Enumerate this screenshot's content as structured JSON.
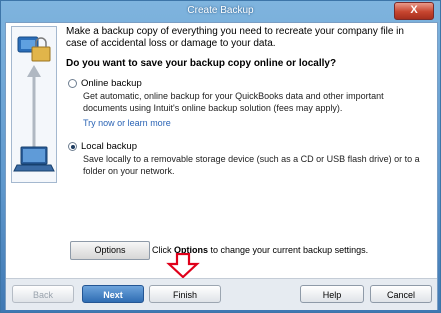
{
  "window": {
    "title": "Create Backup",
    "close_label": "X"
  },
  "intro": "Make a backup copy of everything you need to recreate your company file in case of accidental loss or damage to your data.",
  "question": "Do you want to save your backup copy online or locally?",
  "options": {
    "online": {
      "label": "Online backup",
      "description": "Get automatic, online backup for your QuickBooks data and other important documents using Intuit's online backup solution (fees may apply).",
      "link": "Try now or learn more",
      "selected": false
    },
    "local": {
      "label": "Local backup",
      "description": "Save locally to a removable storage device (such as a CD or USB flash drive) or to a folder on your network.",
      "selected": true
    }
  },
  "options_button": {
    "label": "Options"
  },
  "options_hint": {
    "prefix": "Click ",
    "bold": "Options",
    "suffix": " to change your current backup settings."
  },
  "buttons": {
    "back": "Back",
    "next": "Next",
    "finish": "Finish",
    "help": "Help",
    "cancel": "Cancel"
  },
  "colors": {
    "accent": "#2f6db3",
    "arrow": "#e0001a",
    "link": "#2b64b5"
  }
}
